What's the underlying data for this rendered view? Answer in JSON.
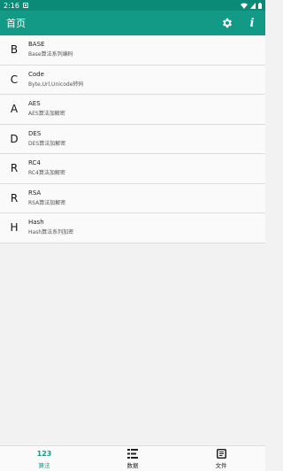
{
  "status": {
    "time": "2:16"
  },
  "header": {
    "title": "首页"
  },
  "items": [
    {
      "letter": "B",
      "name": "BASE",
      "desc": "Base算法系列编码"
    },
    {
      "letter": "C",
      "name": "Code",
      "desc": "Byte,Url,Unicode转码"
    },
    {
      "letter": "A",
      "name": "AES",
      "desc": "AES算法加解密"
    },
    {
      "letter": "D",
      "name": "DES",
      "desc": "DES算法加解密"
    },
    {
      "letter": "R",
      "name": "RC4",
      "desc": "RC4算法加解密"
    },
    {
      "letter": "R",
      "name": "RSA",
      "desc": "RSA算法加解密"
    },
    {
      "letter": "H",
      "name": "Hash",
      "desc": "Hash算法系列加密"
    }
  ],
  "nav": {
    "algo_icon_text": "123",
    "algo_label": "算法",
    "data_label": "数据",
    "file_label": "文件"
  },
  "colors": {
    "primary": "#129a86",
    "statusbar": "#0c8a78"
  }
}
